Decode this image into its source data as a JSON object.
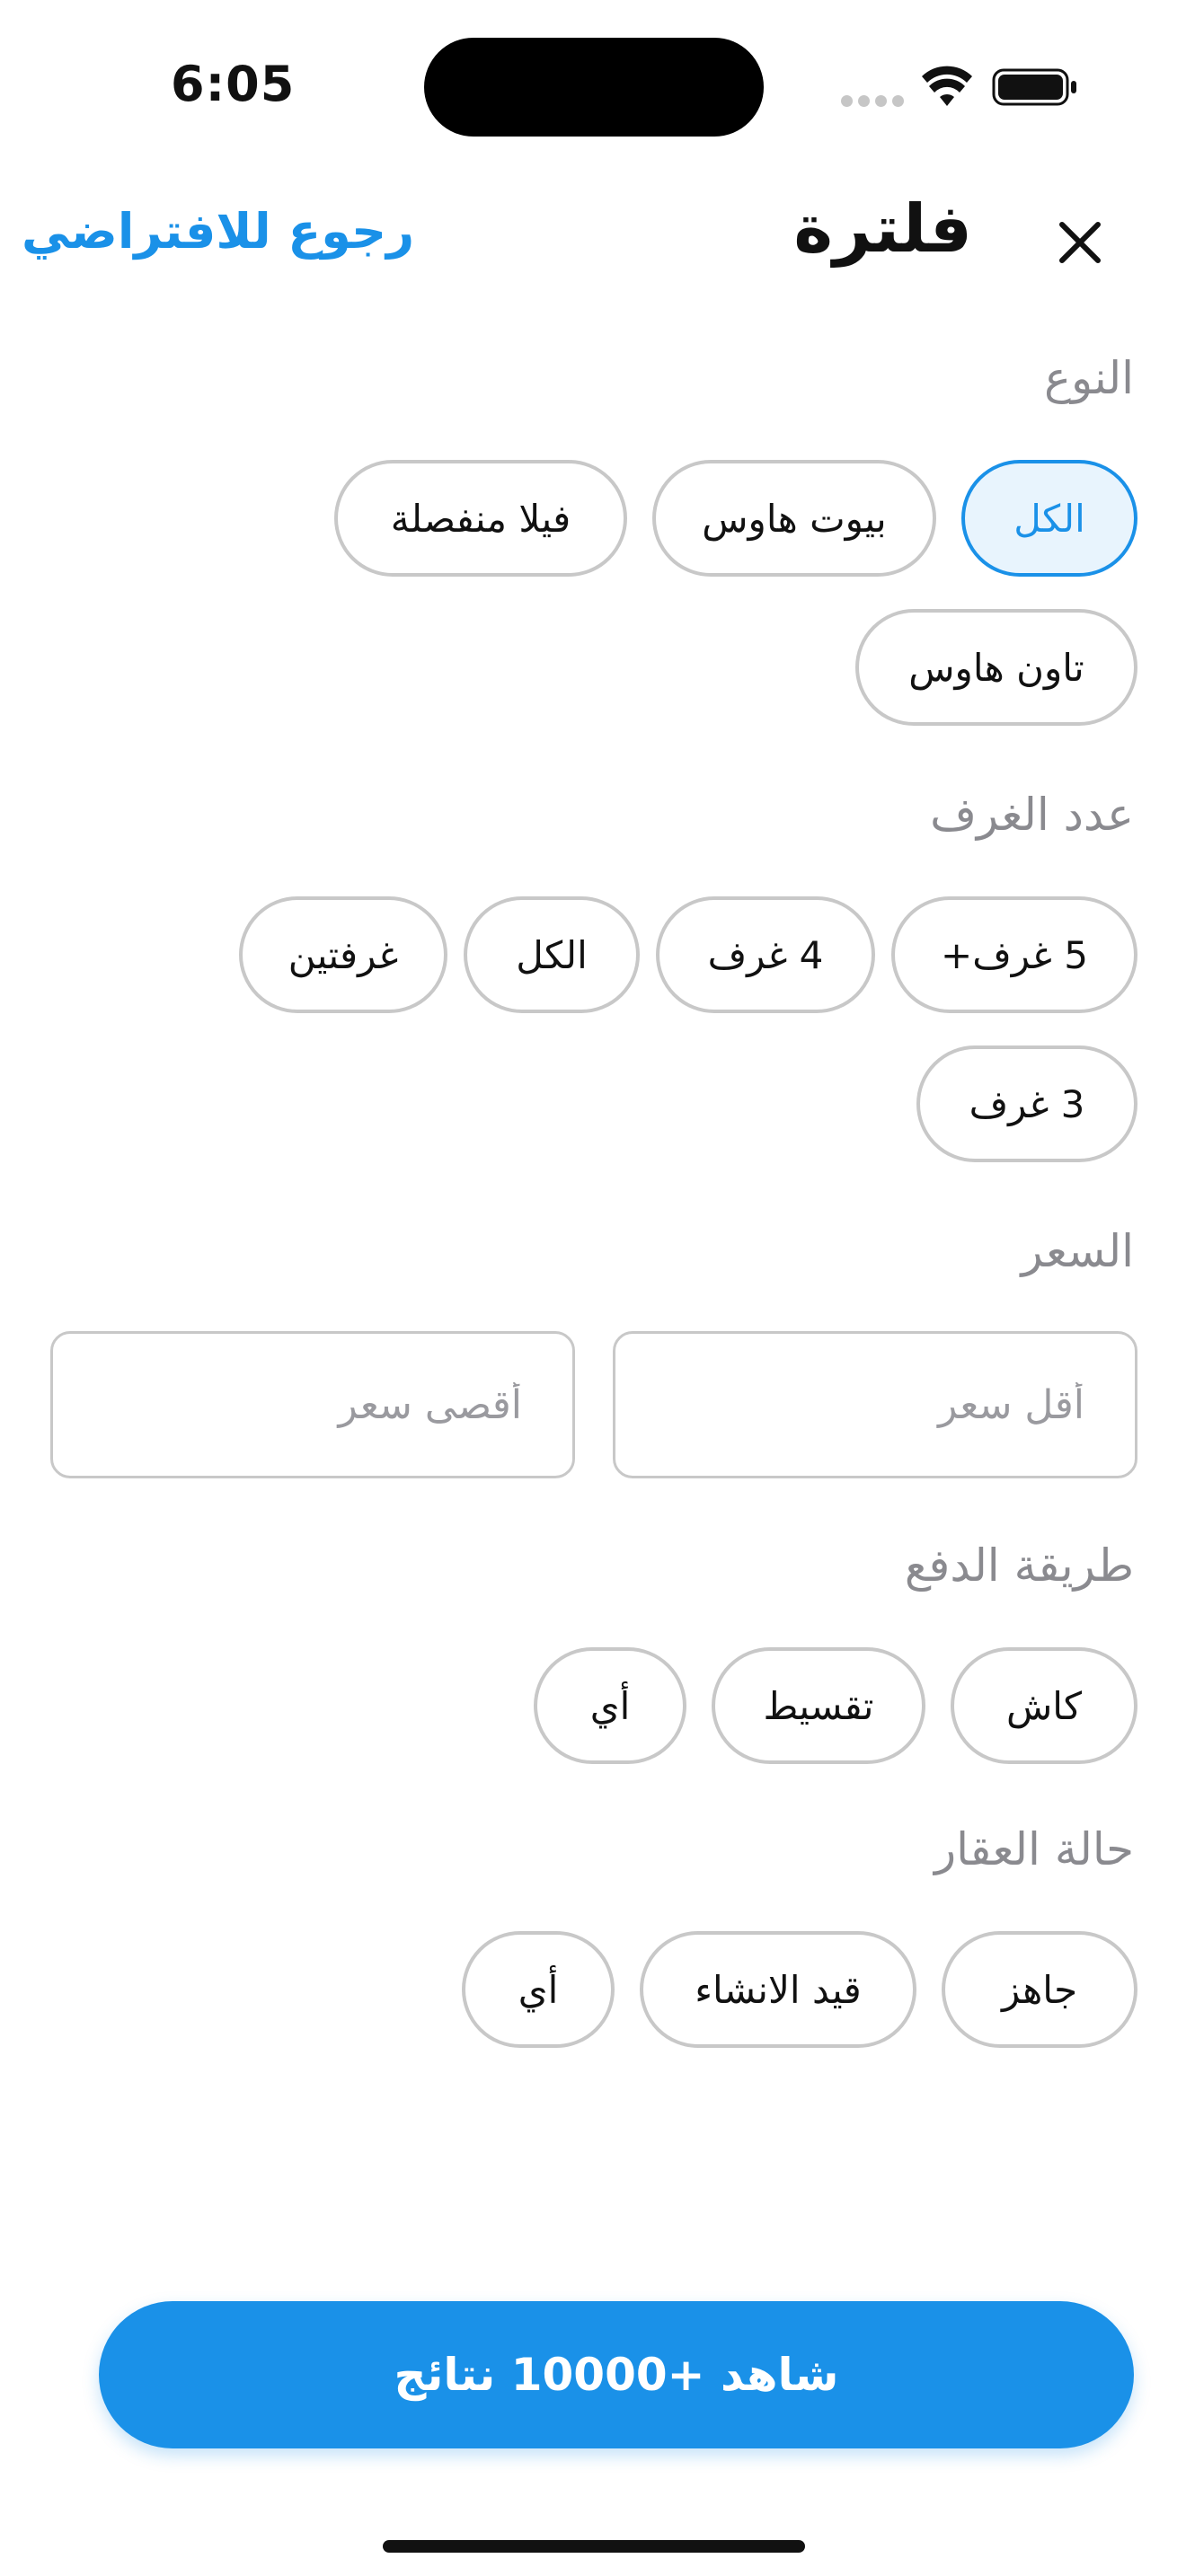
{
  "status_bar": {
    "time": "6:05"
  },
  "header": {
    "title": "فلترة",
    "reset_label": "رجوع للافتراضي"
  },
  "sections": {
    "type": {
      "heading": "النوع",
      "options": [
        "الكل",
        "بيوت هاوس",
        "فيلا منفصلة",
        "تاون هاوس"
      ],
      "selected": "الكل"
    },
    "rooms": {
      "heading": "عدد الغرف",
      "options": [
        "5 غرف+",
        "4 غرف",
        "الكل",
        "غرفتين",
        "3 غرف"
      ]
    },
    "price": {
      "heading": "السعر",
      "min_placeholder": "أقل سعر",
      "max_placeholder": "أقصى سعر",
      "min_value": "",
      "max_value": ""
    },
    "payment": {
      "heading": "طريقة الدفع",
      "options": [
        "كاش",
        "تقسيط",
        "أي"
      ]
    },
    "status": {
      "heading": "حالة العقار",
      "options": [
        "جاهز",
        "قيد الانشاء",
        "أي"
      ]
    }
  },
  "cta": {
    "label": "شاهد +10000 نتائج"
  },
  "colors": {
    "accent": "#1a91e8",
    "chip_border": "#c8c8c8",
    "muted_text": "#8a8a8f"
  },
  "icons": {
    "close": "close-icon",
    "wifi": "wifi-icon",
    "battery": "battery-icon",
    "signal": "signal-dots-icon"
  }
}
